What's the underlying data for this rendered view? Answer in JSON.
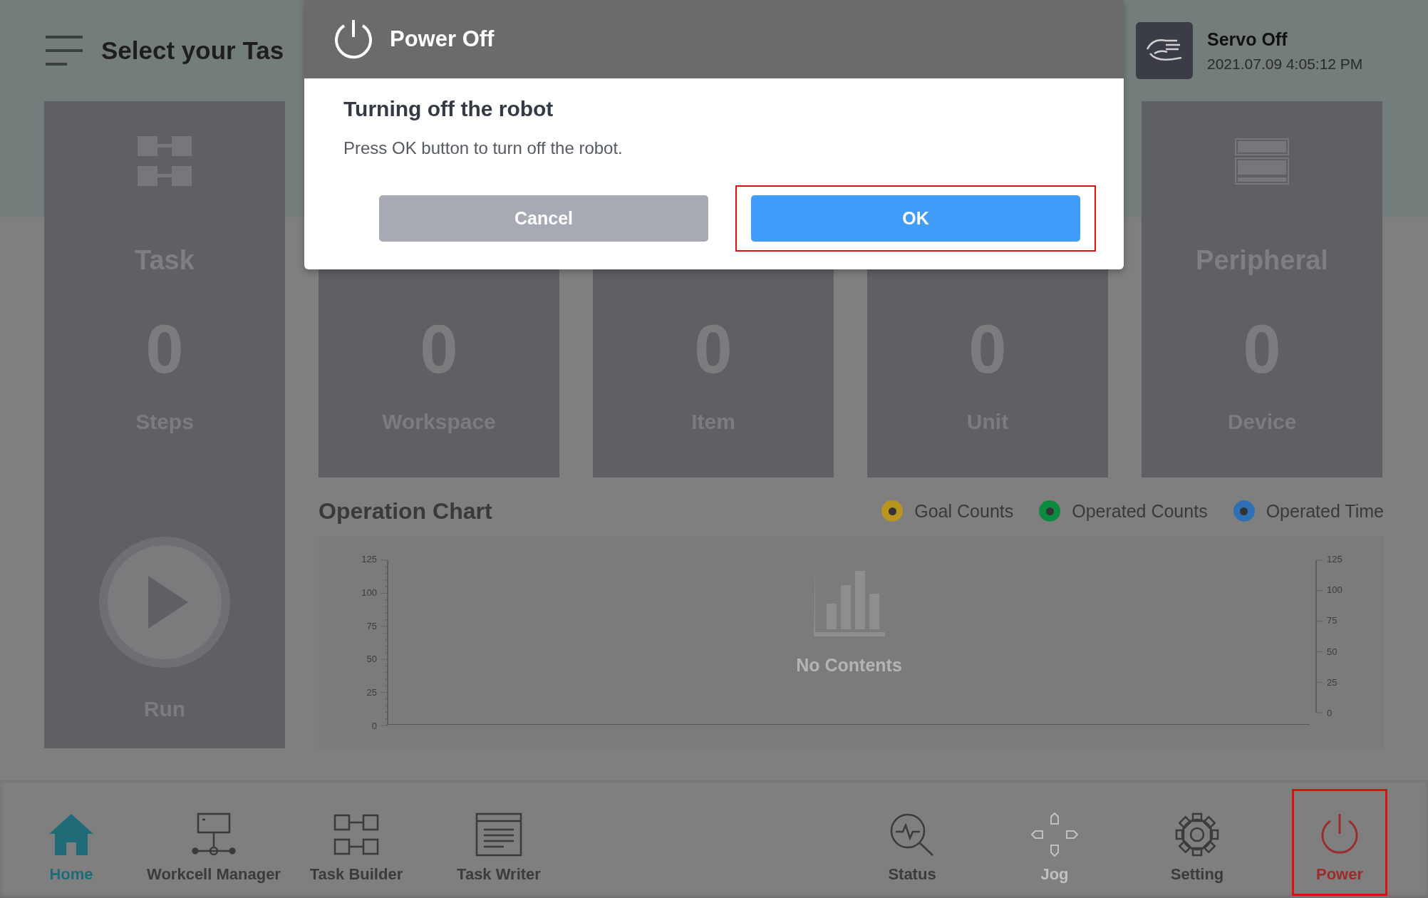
{
  "header": {
    "title": "Select your Tas",
    "servo_status": "Servo Off",
    "datetime": "2021.07.09 4:05:12 PM"
  },
  "task_card": {
    "title": "Task",
    "value": "0",
    "unit": "Steps",
    "run_label": "Run"
  },
  "cards": [
    {
      "kind": "covered",
      "value": "0",
      "unit": "Workspace"
    },
    {
      "kind": "covered",
      "value": "0",
      "unit": "Item"
    },
    {
      "kind": "covered",
      "value": "0",
      "unit": "Unit"
    },
    {
      "kind": "peripheral",
      "title": "Peripheral",
      "value": "0",
      "unit": "Device"
    }
  ],
  "chart": {
    "title": "Operation Chart",
    "legend": [
      {
        "label": "Goal Counts",
        "color": "#b8961e"
      },
      {
        "label": "Operated Counts",
        "color": "#0b8a40"
      },
      {
        "label": "Operated Time",
        "color": "#2f6fb3"
      }
    ],
    "left_ticks": [
      "125",
      "100",
      "75",
      "50",
      "25",
      "0"
    ],
    "right_ticks": [
      "125",
      "100",
      "75",
      "50",
      "25",
      "0"
    ],
    "empty_text": "No Contents"
  },
  "nav": [
    {
      "label": "Home",
      "kind": "home",
      "selected": true,
      "disabled": false,
      "highlighted": false
    },
    {
      "label": "Workcell Manager",
      "kind": "workcell",
      "selected": false,
      "disabled": false,
      "highlighted": false
    },
    {
      "label": "Task Builder",
      "kind": "builder",
      "selected": false,
      "disabled": false,
      "highlighted": false
    },
    {
      "label": "Task Writer",
      "kind": "writer",
      "selected": false,
      "disabled": false,
      "highlighted": false
    },
    {
      "label": "Status",
      "kind": "status",
      "selected": false,
      "disabled": false,
      "highlighted": false
    },
    {
      "label": "Jog",
      "kind": "jog",
      "selected": false,
      "disabled": true,
      "highlighted": false
    },
    {
      "label": "Setting",
      "kind": "setting",
      "selected": false,
      "disabled": false,
      "highlighted": false
    },
    {
      "label": "Power",
      "kind": "power",
      "selected": false,
      "disabled": false,
      "highlighted": true
    }
  ],
  "dialog": {
    "title": "Power Off",
    "heading": "Turning off the robot",
    "message": "Press OK button to turn off the robot.",
    "buttons": [
      {
        "label": "Cancel",
        "kind": "cancel",
        "highlighted": false
      },
      {
        "label": "OK",
        "kind": "primary",
        "highlighted": true
      }
    ]
  }
}
